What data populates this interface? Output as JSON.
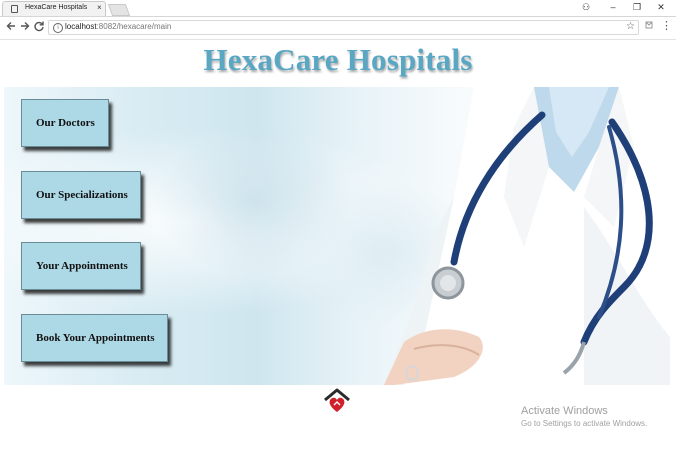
{
  "browser": {
    "tab_title": "HexaCare Hospitals",
    "tab_close": "×",
    "url_host": "localhost",
    "url_path": ":8082/hexacare/main",
    "controls": {
      "account": "⚇",
      "minimize": "–",
      "restore": "❐",
      "close": "✕"
    },
    "icons": [
      "back-icon",
      "forward-icon",
      "reload-icon",
      "info-icon",
      "star-icon",
      "extension-icon",
      "menu-icon"
    ]
  },
  "page": {
    "title": "HexaCare Hospitals",
    "title_color": "#5aa7c4",
    "buttons": [
      {
        "label": "Our Doctors"
      },
      {
        "label": "Our Specializations"
      },
      {
        "label": "Your Appointments"
      },
      {
        "label": "Book Your Appointments"
      }
    ],
    "button_color": "#add8e6",
    "footer_icon": "home-heart-icon"
  },
  "watermark": {
    "line1": "Activate Windows",
    "line2": "Go to Settings to activate Windows."
  }
}
